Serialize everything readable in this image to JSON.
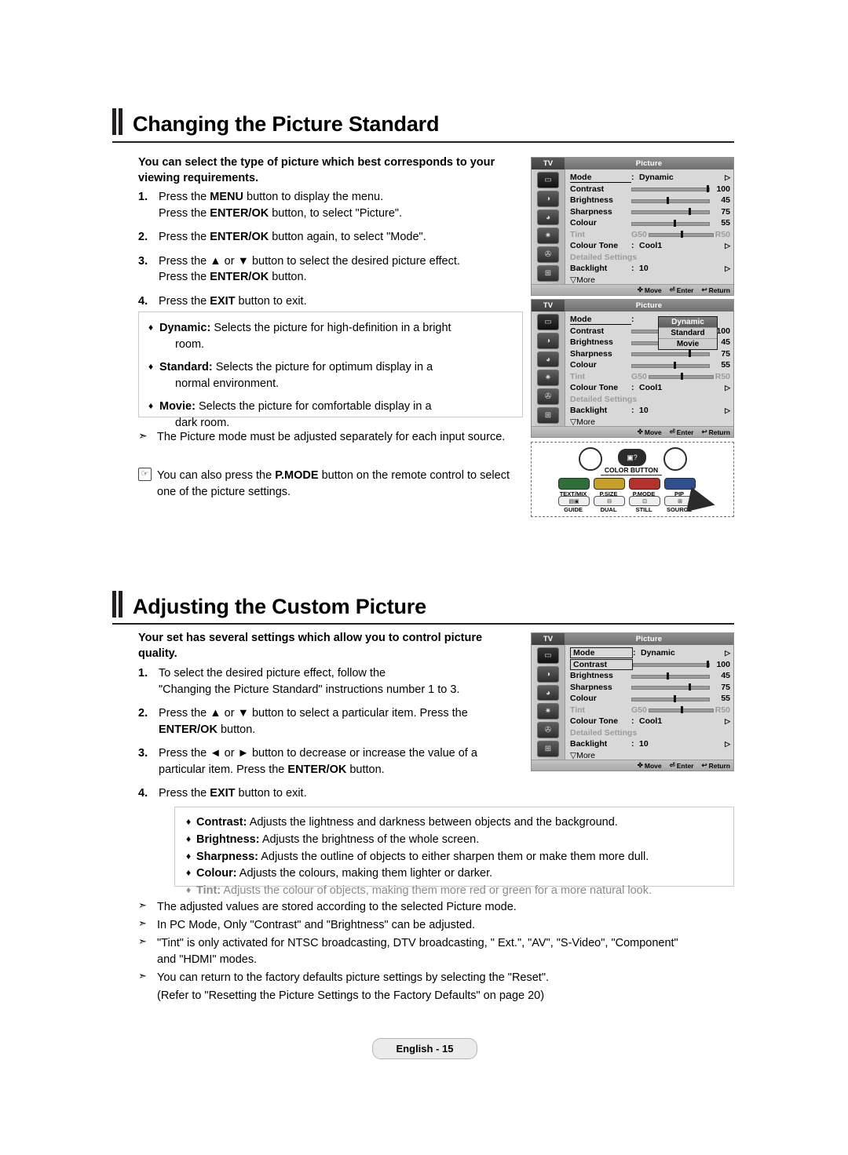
{
  "sections": [
    {
      "title": "Changing the Picture Standard",
      "lead": "You can select the type of picture which best corresponds to your viewing requirements.",
      "steps": [
        {
          "num": "1.",
          "text": "Press the MENU button to display the menu.\nPress the ENTER/OK button, to select \"Picture\"."
        },
        {
          "num": "2.",
          "text": "Press the ENTER/OK button again, to select \"Mode\"."
        },
        {
          "num": "3.",
          "text": "Press the ▲ or ▼ button to select the desired picture effect.\nPress the ENTER/OK button."
        },
        {
          "num": "4.",
          "text": "Press the EXIT button to exit."
        }
      ],
      "bullets": [
        {
          "term": "Dynamic:",
          "desc": "Selects the picture for high-definition in a bright",
          "desc2": "room."
        },
        {
          "term": "Standard:",
          "desc": "Selects the picture for optimum display in a",
          "desc2": "normal environment."
        },
        {
          "term": "Movie:",
          "desc": "Selects the picture for comfortable display in a",
          "desc2": "dark room."
        }
      ],
      "notes": [
        "The Picture mode must be adjusted separately for each input source.",
        "You can also press the P.MODE button on the remote control to select one of the picture settings."
      ]
    },
    {
      "title": "Adjusting the Custom Picture",
      "lead": "Your set has several settings which allow you to control picture quality.",
      "steps": [
        {
          "num": "1.",
          "text": "To select the desired picture effect, follow the\n\"Changing the Picture Standard\" instructions number 1 to 3."
        },
        {
          "num": "2.",
          "text": "Press the ▲ or ▼ button to select a particular item. Press the ENTER/OK button."
        },
        {
          "num": "3.",
          "text": "Press the ◄ or ► button to decrease or increase the value of a particular item. Press the ENTER/OK button."
        },
        {
          "num": "4.",
          "text": "Press the EXIT button to exit."
        }
      ],
      "descriptions": [
        {
          "term": "Contrast:",
          "desc": "Adjusts the lightness and darkness between objects and the background.",
          "faded": false
        },
        {
          "term": "Brightness:",
          "desc": "Adjusts the brightness of the whole screen.",
          "faded": false
        },
        {
          "term": "Sharpness:",
          "desc": "Adjusts the outline of objects to either sharpen them or make them more dull.",
          "faded": false
        },
        {
          "term": "Colour:",
          "desc": "Adjusts the colours, making them lighter or darker.",
          "faded": false
        },
        {
          "term": "Tint:",
          "desc": "Adjusts the colour of objects, making them more red or green for a more natural look.",
          "faded": true
        }
      ],
      "notes": [
        "The adjusted values are stored according to the selected Picture mode.",
        "In PC Mode, Only \"Contrast\" and \"Brightness\" can be adjusted.",
        "\"Tint\" is only activated for NTSC broadcasting, DTV broadcasting, \" Ext.\", \"AV\", \"S-Video\", \"Component\" and \"HDMI\" modes.",
        "You can return to the factory defaults picture settings by selecting the \"Reset\"."
      ],
      "note_extra": "(Refer to \"Resetting the Picture Settings to the Factory Defaults\" on page 20)"
    }
  ],
  "osd": {
    "tv_label": "TV",
    "title": "Picture",
    "footer": {
      "move": "Move",
      "enter": "Enter",
      "return": "Return"
    },
    "rows": [
      {
        "label": "Mode",
        "colon": ":",
        "value": "Dynamic"
      },
      {
        "label": "Contrast",
        "value": "100"
      },
      {
        "label": "Brightness",
        "value": "45"
      },
      {
        "label": "Sharpness",
        "value": "75"
      },
      {
        "label": "Colour",
        "value": "55"
      },
      {
        "label": "Tint",
        "left": "G50",
        "right": "R50"
      },
      {
        "label": "Colour Tone",
        "colon": ":",
        "value": "Cool1"
      },
      {
        "label": "Detailed Settings"
      },
      {
        "label": "Backlight",
        "colon": ":",
        "value": "10"
      },
      {
        "label": "More",
        "value": ""
      }
    ],
    "more_label": "More",
    "dropdown": {
      "items": [
        "Dynamic",
        "Standard",
        "Movie"
      ],
      "selected": "Dynamic"
    }
  },
  "remote": {
    "color_button_label": "COLOR BUTTON",
    "buttons_row1": [
      "TEXT/MIX",
      "P.SIZE",
      "P.MODE",
      "PIP"
    ],
    "buttons_row2": [
      "GUIDE",
      "DUAL",
      "STILL",
      "SOURCE"
    ]
  },
  "footer": {
    "page_label": "English - 15"
  }
}
